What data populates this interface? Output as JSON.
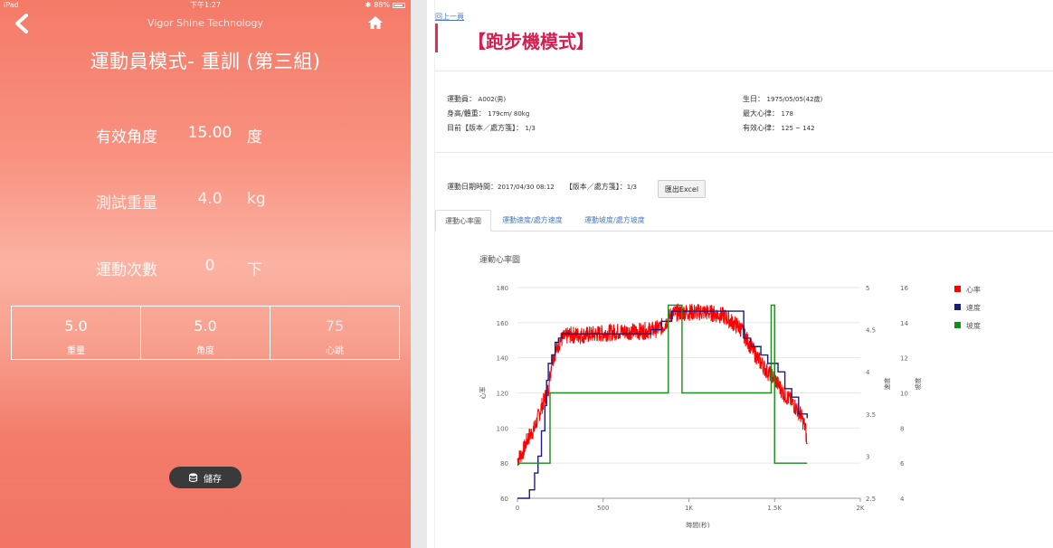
{
  "status_bar": {
    "device": "iPad",
    "time": "下午1:27",
    "battery": "88%"
  },
  "app": {
    "title": "Vigor Shine Technology",
    "mode_title": "運動員模式- 重訓 (第三組)",
    "params": [
      {
        "label": "有效角度",
        "value": "15.00",
        "unit": "度"
      },
      {
        "label": "測試重量",
        "value": "4.0",
        "unit": "kg"
      },
      {
        "label": "運動次數",
        "value": "0",
        "unit": "下"
      }
    ],
    "stats": [
      {
        "value": "5.0",
        "label": "重量"
      },
      {
        "value": "5.0",
        "label": "角度"
      },
      {
        "value": "75",
        "label": "心跳"
      }
    ],
    "save_label": "儲存"
  },
  "web": {
    "back_link": "回上一頁",
    "page_title": "【跑步機模式】",
    "athlete_label": "運動員：",
    "athlete_value": "A002(男)",
    "height_weight_label": "身高/體重：",
    "height_weight_value": "179cm/ 80kg",
    "version_label": "目前【版本／處方箋】：",
    "version_value": "1/3",
    "birth_label": "生日：",
    "birth_value": "1975/05/05(42歲)",
    "max_hr_label": "最大心律：",
    "max_hr_value": "178",
    "effective_hr_label": "有效心律：",
    "effective_hr_value": "125 ~ 142",
    "session_time_label": "運動日期時間：",
    "session_time_value": "2017/04/30 08:12",
    "session_version_label": "【版本／處方箋】：",
    "session_version_value": "1/3",
    "excel_button": "匯出Excel",
    "tabs": [
      "運動心率圖",
      "運動速度/處方速度",
      "運動坡度/處方坡度"
    ],
    "active_tab": 0
  },
  "chart_data": {
    "type": "line",
    "title": "運動心率圖",
    "xlabel": "時間(秒)",
    "x_ticks": [
      "0",
      "500",
      "1K",
      "1.5K",
      "2K"
    ],
    "xlim": [
      0,
      2000
    ],
    "axes": [
      {
        "id": "hr",
        "label": "心率",
        "range": [
          60,
          180
        ],
        "ticks": [
          "60",
          "80",
          "100",
          "120",
          "140",
          "160",
          "180"
        ]
      },
      {
        "id": "speed",
        "label": "速度",
        "range": [
          2.5,
          5
        ],
        "ticks": [
          "2.5",
          "3",
          "3.5",
          "4",
          "4.5",
          "5"
        ]
      },
      {
        "id": "grade",
        "label": "坡度",
        "range": [
          4,
          16
        ],
        "ticks": [
          "4",
          "6",
          "8",
          "10",
          "12",
          "14",
          "16"
        ]
      }
    ],
    "legend_position": "right",
    "grid": true,
    "series": [
      {
        "name": "心率",
        "axis": "hr",
        "color": "#ff0000",
        "noise": 5,
        "x": [
          0,
          30,
          60,
          100,
          140,
          180,
          200,
          250,
          300,
          400,
          500,
          600,
          700,
          800,
          850,
          900,
          950,
          1000,
          1100,
          1200,
          1300,
          1340,
          1400,
          1450,
          1500,
          1550,
          1600,
          1650,
          1680,
          1690
        ],
        "y": [
          82,
          86,
          94,
          100,
          112,
          122,
          138,
          150,
          153,
          153,
          154,
          155,
          155,
          156,
          158,
          165,
          166,
          166,
          166,
          164,
          157,
          150,
          140,
          133,
          128,
          120,
          115,
          108,
          100,
          88
        ]
      },
      {
        "name": "速度",
        "axis": "speed",
        "color": "#1c1c80",
        "step": true,
        "x": [
          0,
          70,
          100,
          120,
          140,
          160,
          170,
          180,
          200,
          220,
          240,
          260,
          550,
          780,
          840,
          900,
          1320,
          1360,
          1420,
          1460,
          1520,
          1560,
          1600,
          1640,
          1690
        ],
        "y": [
          2.5,
          2.6,
          2.8,
          3.0,
          3.3,
          3.6,
          3.9,
          4.1,
          4.2,
          4.35,
          4.4,
          4.45,
          4.45,
          4.5,
          4.6,
          4.72,
          4.4,
          4.3,
          4.2,
          4.1,
          4.0,
          3.8,
          3.7,
          3.5,
          3.45
        ]
      },
      {
        "name": "坡度",
        "axis": "grade",
        "color": "#1a8a1a",
        "step": true,
        "x": [
          0,
          190,
          880,
          960,
          1480,
          1500,
          1690
        ],
        "y": [
          6,
          10,
          15,
          10,
          15,
          6,
          6
        ]
      }
    ]
  }
}
